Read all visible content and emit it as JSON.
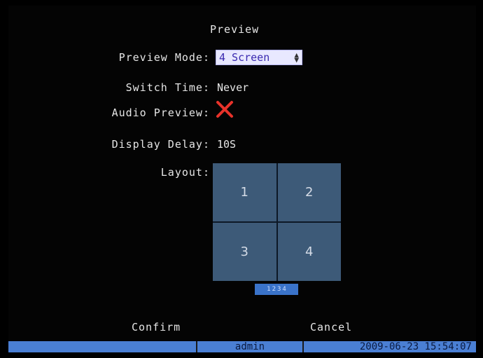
{
  "screen_title": "Preview",
  "fields": {
    "preview_mode": {
      "label": "Preview Mode:",
      "value": "4 Screen"
    },
    "switch_time": {
      "label": "Switch Time:",
      "value": "Never"
    },
    "audio_preview": {
      "label": "Audio Preview:",
      "state_icon": "x-mark-icon",
      "checked": false
    },
    "display_delay": {
      "label": "Display Delay:",
      "value": "10S"
    },
    "layout": {
      "label": "Layout:",
      "cells": [
        "1",
        "2",
        "3",
        "4"
      ]
    }
  },
  "pager": [
    "1",
    "2",
    "3",
    "4"
  ],
  "buttons": {
    "confirm": "Confirm",
    "cancel": "Cancel"
  },
  "status": {
    "user": "admin",
    "datetime": "2009-06-23 15:54:07"
  },
  "colors": {
    "select_bg": "#e8e8ff",
    "cell": "#3d5a78",
    "status": "#4a7fd4",
    "xmark": "#e8322a"
  }
}
